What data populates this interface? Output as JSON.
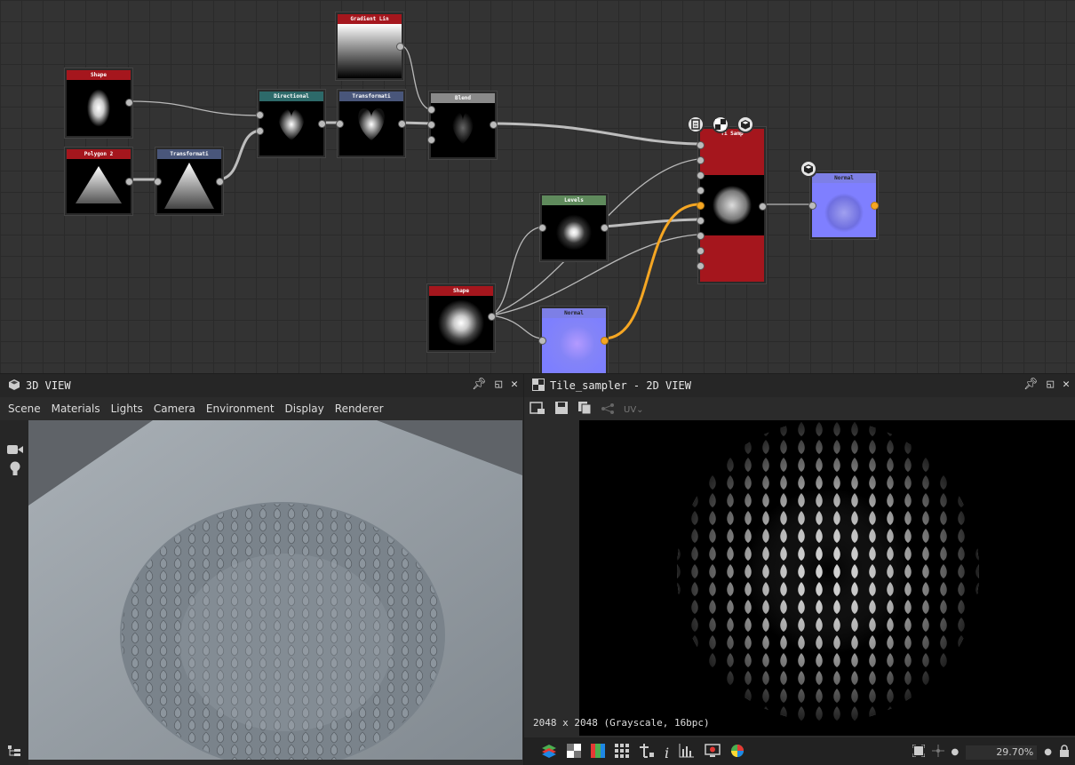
{
  "graph": {
    "nodes": {
      "shape1": "Shape",
      "polygon2": "Polygon 2",
      "transform1": "Transformati",
      "directional": "Directional",
      "transform2": "Transformati",
      "gradient": "Gradient Lin",
      "blend": "Blend",
      "tile_sampler": "Ti  Samp",
      "levels": "Levels",
      "shape2": "Shape",
      "normal1": "Normal",
      "normal2": "Normal"
    },
    "colors": {
      "red": "#a5161d",
      "teal": "#2d6a6a",
      "slate": "#49567a",
      "grey": "#8a8a8a",
      "green": "#5f8a5c",
      "accent": "#f5a623"
    }
  },
  "view3d": {
    "title": "3D VIEW",
    "menu": [
      "Scene",
      "Materials",
      "Lights",
      "Camera",
      "Environment",
      "Display",
      "Renderer"
    ]
  },
  "view2d": {
    "title": "Tile_sampler - 2D VIEW",
    "uv_label": "UV",
    "info": "2048 x 2048 (Grayscale, 16bpc)",
    "zoom": "29.70%"
  }
}
